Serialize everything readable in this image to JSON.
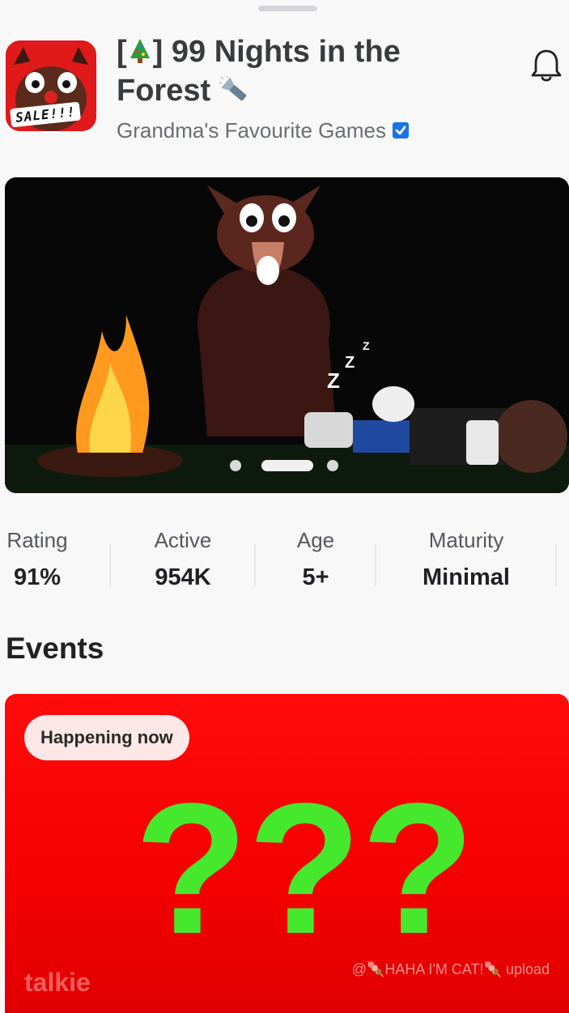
{
  "game": {
    "title_prefix": "[",
    "title_suffix": "] 99 Nights in the",
    "title_line2": "Forest",
    "creator": "Grandma's Favourite Games",
    "thumbnail_badge": "SALE!!!"
  },
  "icons": {
    "tree": "christmas-tree-icon",
    "flashlight": "flashlight-icon",
    "verified": "verified-badge-icon",
    "bell": "bell-icon"
  },
  "carousel": {
    "slides": 3,
    "active_index": 1
  },
  "stats": [
    {
      "label": "Rating",
      "value": "91%"
    },
    {
      "label": "Active",
      "value": "954K"
    },
    {
      "label": "Age",
      "value": "5+"
    },
    {
      "label": "Maturity",
      "value": "Minimal"
    }
  ],
  "events": {
    "heading": "Events",
    "card": {
      "badge": "Happening now",
      "watermark_left": "talkie",
      "watermark_right": "@🍡HAHA I'M CAT!🍡 upload"
    }
  },
  "colors": {
    "verified_blue": "#1a73e8",
    "event_red": "#f40000",
    "question_green": "#45e82d"
  }
}
